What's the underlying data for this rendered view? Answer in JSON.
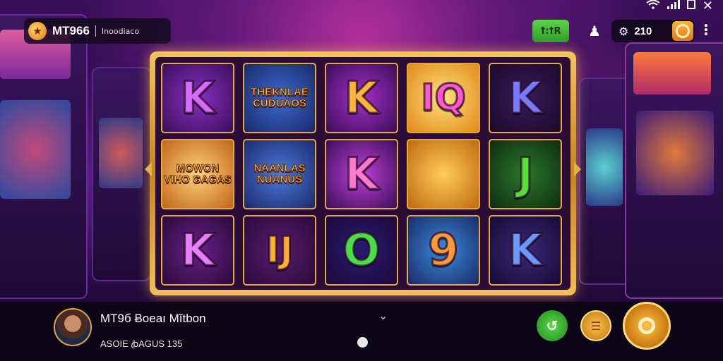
{
  "header": {
    "brand_name": "MT966",
    "brand_sub": "Ιnoodiaco",
    "green_button_label": "ꝉ꞉ꝉR",
    "credits": "210",
    "icons": [
      "star-logo-icon",
      "wifi-icon",
      "signal-icon",
      "battery-icon",
      "close-icon",
      "user-icon",
      "gear-icon",
      "coin-icon",
      "more-vertical-icon"
    ]
  },
  "reels": [
    [
      {
        "type": "letter",
        "text": "K",
        "color": "#d86bff",
        "bg": "radial-gradient(circle,#8a2fc0,#3a0f5a)"
      },
      {
        "type": "badge",
        "text": "MOWON VIHO GAGAS",
        "bg": "radial-gradient(circle,#ffd27a,#c0661a)"
      },
      {
        "type": "letter",
        "text": "K",
        "color": "#e680ff",
        "bg": "radial-gradient(circle,#6a1f88,#2a0b3a)"
      }
    ],
    [
      {
        "type": "badge",
        "text": "THEKNLAE CUDUAOS",
        "bg": "radial-gradient(circle,#3a6ad0,#1a2a6a)"
      },
      {
        "type": "badge",
        "text": "NAANLAS NUANUS",
        "bg": "radial-gradient(circle,#4a7ad8,#1c2a6e)"
      },
      {
        "type": "letter",
        "text": "IJ",
        "color": "#ffb230",
        "bg": "radial-gradient(circle,#5a1a70,#2a0b3a)"
      }
    ],
    [
      {
        "type": "letter",
        "text": "K",
        "color": "#ffb43a",
        "bg": "radial-gradient(circle,#a430c8,#3a0e58)"
      },
      {
        "type": "letter",
        "text": "K",
        "color": "#ff7ad0",
        "bg": "radial-gradient(circle,#c040d8,#3a0e58)"
      },
      {
        "type": "letter",
        "text": "O",
        "color": "#4adf4a",
        "bg": "radial-gradient(circle,#2a1a70,#1a0a3a)"
      }
    ],
    [
      {
        "type": "letter",
        "text": "IQ",
        "color": "#ff5ad0",
        "bg": "radial-gradient(circle,#ffe07a,#e08a1a)"
      },
      {
        "type": "badge",
        "text": "",
        "bg": "radial-gradient(circle,#ffcc5a,#c06a10)"
      },
      {
        "type": "letter",
        "text": "9",
        "color": "#ff9a3a",
        "bg": "radial-gradient(circle,#3a8ad8,#1a2a6a)"
      }
    ],
    [
      {
        "type": "letter",
        "text": "K",
        "color": "#7a7aff",
        "bg": "radial-gradient(circle,#3a1a5a,#1a0a2a)"
      },
      {
        "type": "letter",
        "text": "J",
        "color": "#5adf3a",
        "bg": "radial-gradient(circle,#2a7a2a,#102a12)"
      },
      {
        "type": "letter",
        "text": "K",
        "color": "#6a9aff",
        "bg": "radial-gradient(circle,#3a2a7a,#160a34)"
      }
    ]
  ],
  "footer": {
    "player_name": "MT9б Ƀoeaı Mĭtbon",
    "player_info": "ASOIE ꞗAGUS 135"
  }
}
